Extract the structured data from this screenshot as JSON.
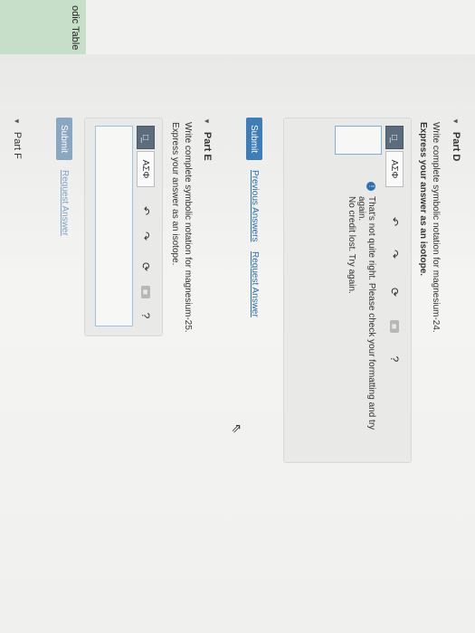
{
  "sidebar": {
    "tab_label": "odic Table"
  },
  "part_d": {
    "title": "Part D",
    "prompt": "Write complete symbolic notation for magnesium-24.",
    "instruction": "Express your answer as an isotope.",
    "toolbar": {
      "symbols_label": "ΑΣΦ",
      "help_label": "?"
    },
    "feedback_line1": "That's not quite right. Please check your formatting and try again.",
    "feedback_line2": "No credit lost. Try again.",
    "submit_label": "Submit",
    "previous_answers_label": "Previous Answers",
    "request_answer_label": "Request Answer"
  },
  "part_e": {
    "title": "Part E",
    "prompt": "Write complete symbolic notation for magnesium-25.",
    "instruction": "Express your answer as an isotope.",
    "toolbar": {
      "symbols_label": "ΑΣΦ",
      "help_label": "?"
    },
    "submit_label": "Submit",
    "request_answer_label": "Request Answer"
  },
  "part_f": {
    "title": "Part F"
  }
}
